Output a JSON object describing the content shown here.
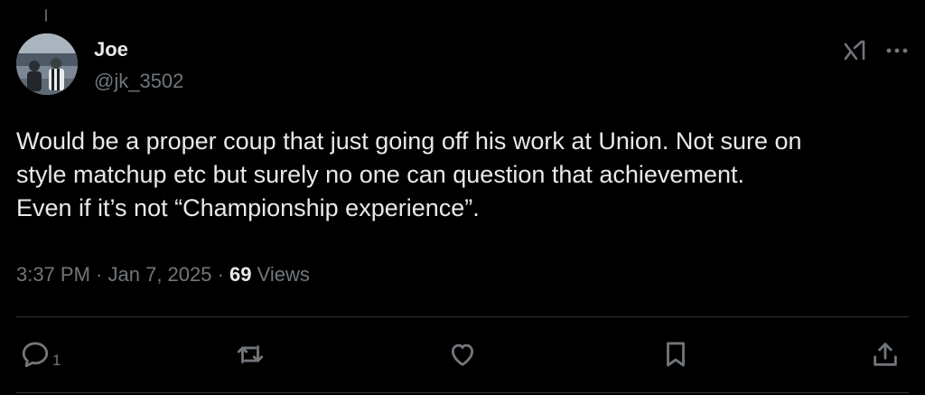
{
  "author": {
    "display_name": "Joe",
    "handle": "@jk_3502"
  },
  "icons": {
    "grok": "grok-icon",
    "more": "more-horizontal-icon",
    "reply": "reply-icon",
    "repost": "repost-icon",
    "like": "like-icon",
    "bookmark": "bookmark-icon",
    "share": "share-icon"
  },
  "tweet": {
    "lines": [
      "Would be a proper coup that just going off his work at Union. Not sure on",
      "style matchup etc but surely no one can question that achievement.",
      "Even if it’s not “Championship experience”."
    ]
  },
  "meta": {
    "time": "3:37 PM",
    "separator": " · ",
    "date": "Jan 7, 2025",
    "views_count": "69",
    "views_label": " Views"
  },
  "actions": {
    "reply_count": "1"
  },
  "colors": {
    "background": "#000000",
    "text_primary": "#e7e9ea",
    "text_secondary": "#71767b",
    "divider": "#2f3336"
  }
}
